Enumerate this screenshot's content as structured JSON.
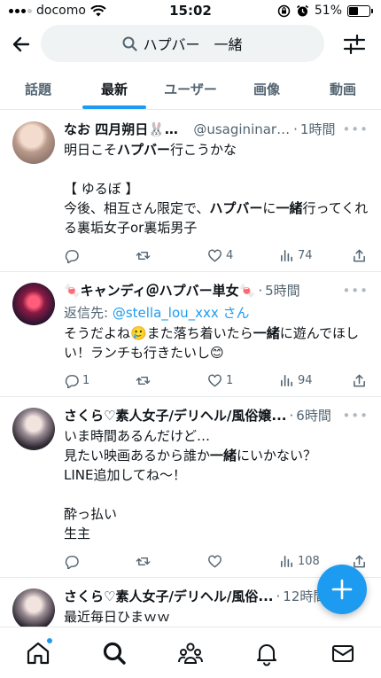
{
  "status_bar": {
    "carrier": "docomo",
    "time": "15:02",
    "battery": "51%",
    "battery_level": 0.51
  },
  "search": {
    "query": "ハプバー　一緒"
  },
  "tabs": [
    {
      "label": "話題",
      "active": false
    },
    {
      "label": "最新",
      "active": true
    },
    {
      "label": "ユーザー",
      "active": false
    },
    {
      "label": "画像",
      "active": false
    },
    {
      "label": "動画",
      "active": false
    }
  ],
  "tweets": [
    {
      "name": "なお 四月朔日🐰🐰©",
      "handle": "@usagininarit...",
      "time": "1時間",
      "reply_to": "",
      "text_html": "明日こそ<b>ハプバー</b>行こうかな\n\n【 ゆるぼ 】\n今後、相互さん限定で、<b>ハプバー</b>に<b>一緒</b>行ってくれる裏垢女子or裏垢男子",
      "replies": "",
      "retweets": "",
      "likes": "4",
      "views": "74"
    },
    {
      "name": "🍬キャンディ＠ハプバー単女🍬",
      "handle": "",
      "time": "5時間",
      "reply_prefix": "返信先: ",
      "reply_to": "@stella_lou_xxx",
      "reply_suffix": " さん",
      "text_html": "そうだよね🥲また落ち着いたら<b>一緒</b>に遊んでほしい！ランチも行きたいし😊",
      "replies": "1",
      "retweets": "",
      "likes": "1",
      "views": "94"
    },
    {
      "name": "さくら♡素人女子/デリヘル/風俗嬢...",
      "handle": "",
      "time": "6時間",
      "reply_to": "",
      "text_html": "いま時間あるんだけど…\n見たい映画あるから誰か<b>一緒</b>にいかない？\nLINE追加してね〜！\n\n酔っ払い\n生主",
      "replies": "",
      "retweets": "",
      "likes": "",
      "views": "108"
    },
    {
      "name": "さくら♡素人女子/デリヘル/風俗...",
      "handle": "",
      "time": "12時間",
      "reply_to": "",
      "text_html": "最近毎日ひまｗｗ\n映画好きな人<b>一緒</b>に見に行かない？",
      "replies": "",
      "retweets": "",
      "likes": "",
      "views": ""
    }
  ],
  "icons": {
    "back": "arrow-left-icon",
    "search": "search-icon",
    "filter": "sliders-icon",
    "compose": "plus-icon",
    "nav": [
      "home-icon",
      "search-icon",
      "communities-icon",
      "bell-icon",
      "mail-icon"
    ]
  },
  "colors": {
    "accent": "#1d9bf0",
    "muted": "#536471"
  }
}
